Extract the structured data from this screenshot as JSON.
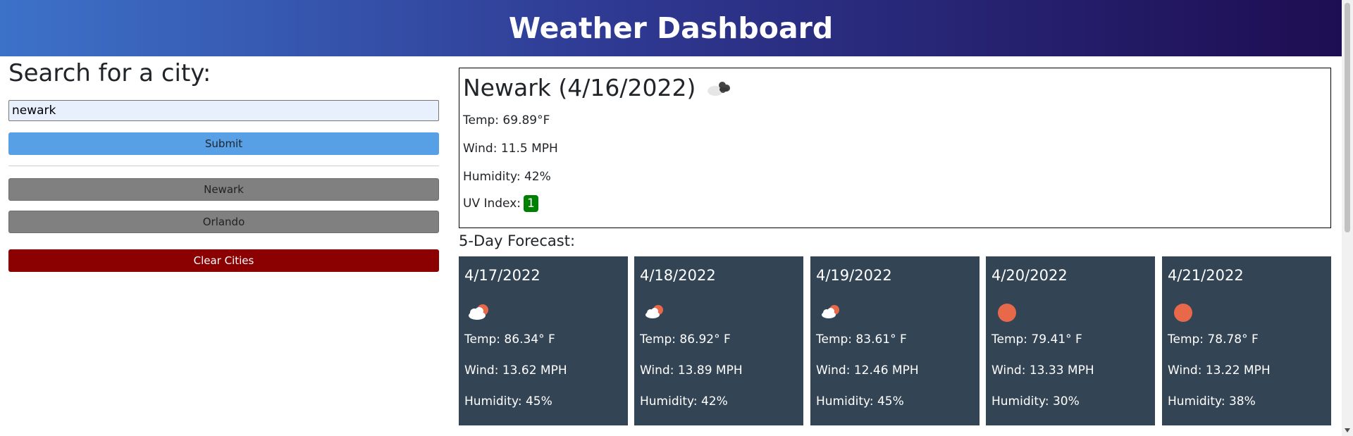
{
  "header": {
    "title": "Weather Dashboard"
  },
  "search": {
    "heading": "Search for a city:",
    "input_value": "newark",
    "submit_label": "Submit",
    "history": [
      "Newark",
      "Orlando"
    ],
    "clear_label": "Clear Cities"
  },
  "current": {
    "title": "Newark (4/16/2022)",
    "icon": "clouds-icon",
    "temp": "Temp: 69.89°F",
    "wind": "Wind: 11.5 MPH",
    "humidity": "Humidity: 42%",
    "uv_label": "UV Index:",
    "uv_value": "1",
    "uv_color": "#008000"
  },
  "forecast": {
    "heading": "5-Day Forecast:",
    "days": [
      {
        "date": "4/17/2022",
        "icon": "partly-cloudy-icon",
        "temp": "Temp: 86.34° F",
        "wind": "Wind: 13.62 MPH",
        "humidity": "Humidity: 45%"
      },
      {
        "date": "4/18/2022",
        "icon": "partly-cloudy-icon",
        "temp": "Temp: 86.92° F",
        "wind": "Wind: 13.89 MPH",
        "humidity": "Humidity: 42%"
      },
      {
        "date": "4/19/2022",
        "icon": "partly-cloudy-icon",
        "temp": "Temp: 83.61° F",
        "wind": "Wind: 12.46 MPH",
        "humidity": "Humidity: 45%"
      },
      {
        "date": "4/20/2022",
        "icon": "sun-icon",
        "temp": "Temp: 79.41° F",
        "wind": "Wind: 13.33 MPH",
        "humidity": "Humidity: 30%"
      },
      {
        "date": "4/21/2022",
        "icon": "sun-icon",
        "temp": "Temp: 78.78° F",
        "wind": "Wind: 13.22 MPH",
        "humidity": "Humidity: 38%"
      }
    ]
  },
  "colors": {
    "card_bg": "#334455",
    "submit_bg": "#58a0e6",
    "clear_bg": "#8b0000",
    "history_bg": "#808080",
    "sun": "#e8684a"
  }
}
